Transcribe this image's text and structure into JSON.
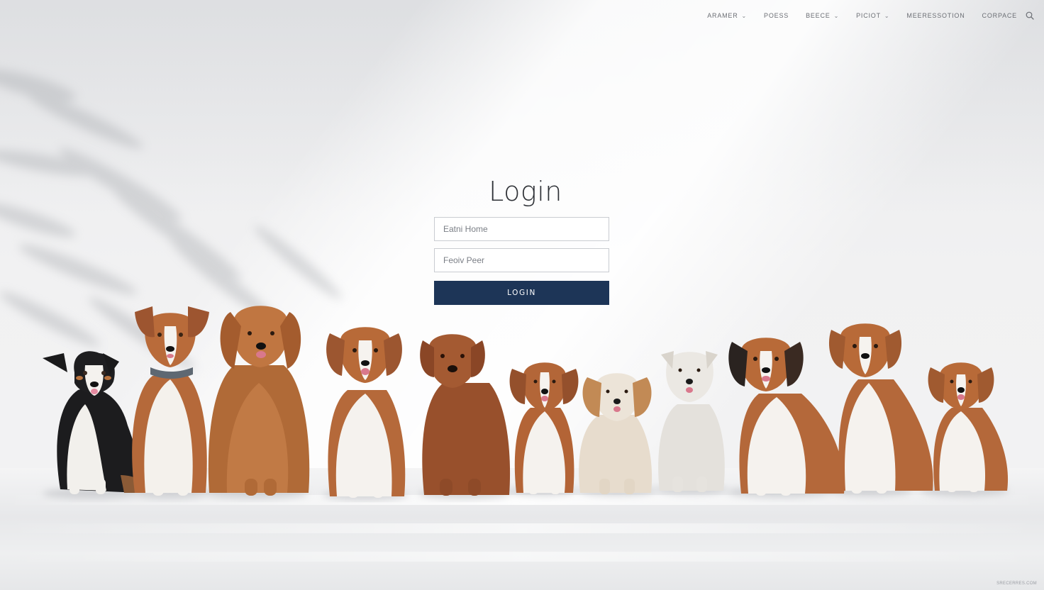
{
  "nav": {
    "items": [
      {
        "label": "ARAMER",
        "has_dropdown": true
      },
      {
        "label": "POESS",
        "has_dropdown": false
      },
      {
        "label": "BEECE",
        "has_dropdown": true
      },
      {
        "label": "PICIOT",
        "has_dropdown": true
      },
      {
        "label": "MEERESSOTION",
        "has_dropdown": false
      },
      {
        "label": "CORPACE",
        "has_dropdown": false
      }
    ],
    "chevron": "⌄",
    "search_icon": "search-icon"
  },
  "login": {
    "title": "Login",
    "name_placeholder": "Eatni Home",
    "password_placeholder": "Feoiv Peer",
    "button_label": "LOGIN",
    "button_color": "#1d3557"
  },
  "hero": {
    "subject": "row-of-dogs",
    "dog_count": 11
  },
  "corner_mark": "SRECERRES.COM"
}
